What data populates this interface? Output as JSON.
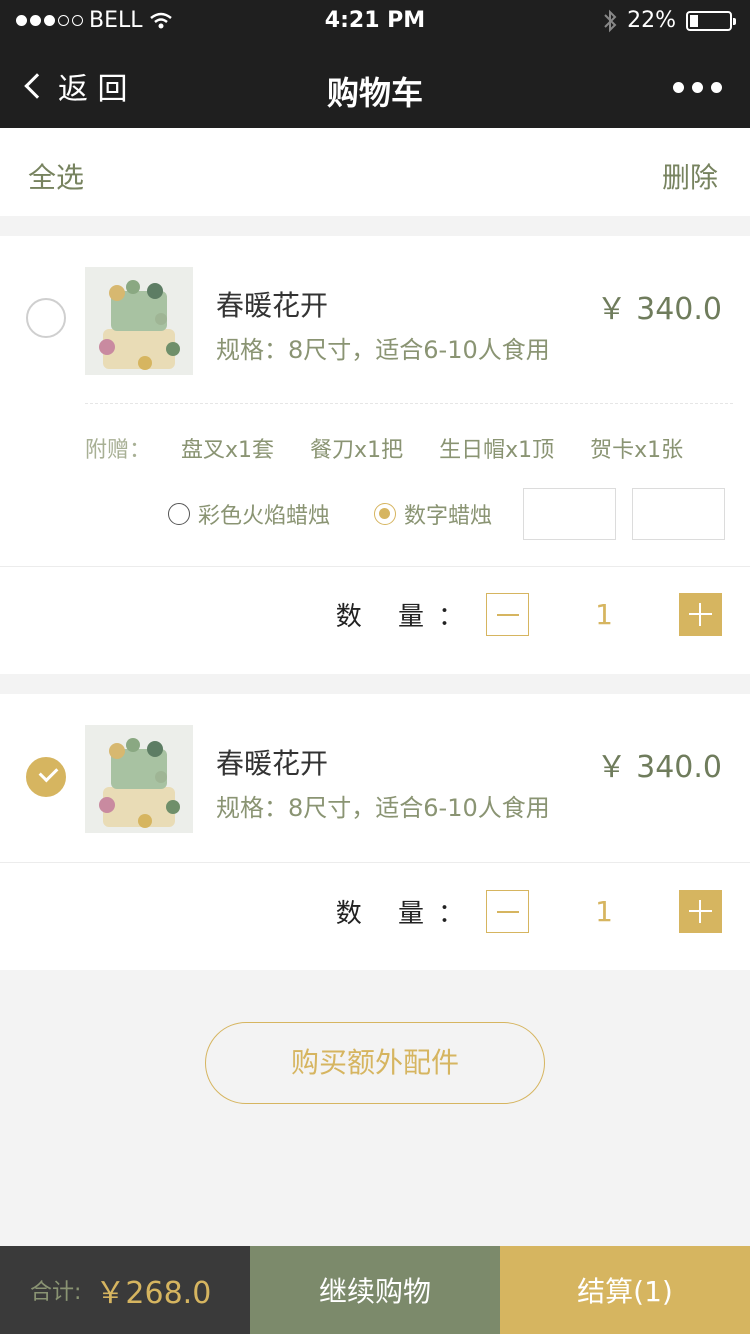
{
  "status": {
    "carrier": "BELL",
    "time": "4:21 PM",
    "battery": "22%",
    "battery_level": 0.22
  },
  "nav": {
    "back_label": "返 回",
    "title": "购物车"
  },
  "selection": {
    "select_all": "全选",
    "delete": "删除"
  },
  "items": [
    {
      "name": "春暖花开",
      "spec": "规格：8尺寸，适合6-10人食用",
      "price": "￥ 340.0",
      "checked": false,
      "gifts_label": "附赠：",
      "gifts": [
        "盘叉x1套",
        "餐刀x1把",
        "生日帽x1顶",
        "贺卡x1张"
      ],
      "candles": [
        "彩色火焰蜡烛",
        "数字蜡烛"
      ],
      "selected_candle": "数字蜡烛",
      "qty_label": "数 量：",
      "qty": "1"
    },
    {
      "name": "春暖花开",
      "spec": "规格：8尺寸，适合6-10人食用",
      "price": "￥ 340.0",
      "checked": true,
      "qty_label": "数 量：",
      "qty": "1"
    }
  ],
  "extra_button": "购买额外配件",
  "footer": {
    "total_label": "合计:",
    "total_value": "￥268.0",
    "continue": "继续购物",
    "checkout": "结算(1)"
  },
  "colors": {
    "accent": "#d6b560",
    "olive": "#7c8a6b",
    "dark": "#1f1f1f"
  }
}
